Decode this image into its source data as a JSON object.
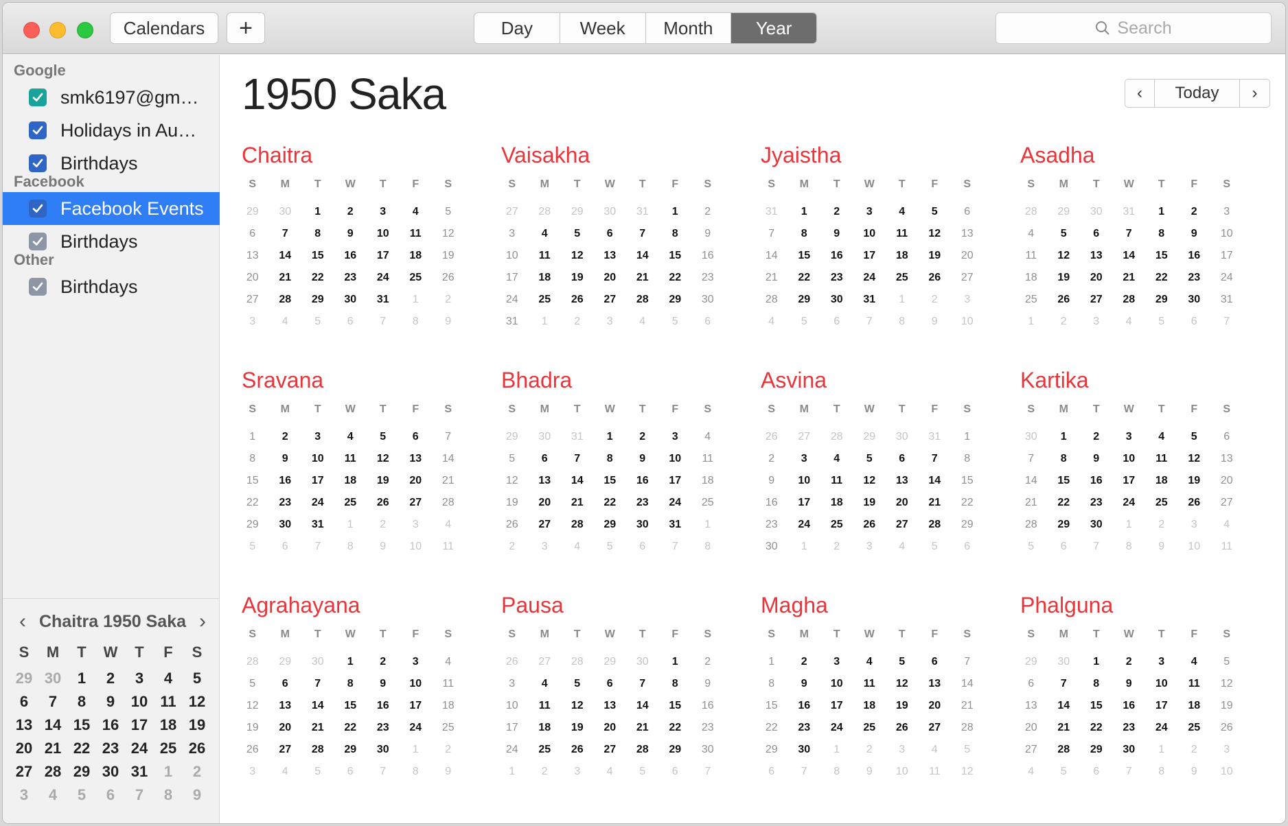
{
  "toolbar": {
    "calendars_label": "Calendars",
    "add_label": "+",
    "views": [
      "Day",
      "Week",
      "Month",
      "Year"
    ],
    "active_view": "Year",
    "search_placeholder": "Search"
  },
  "sidebar": {
    "groups": [
      {
        "title": "Google",
        "items": [
          {
            "label": "smk6197@gm…",
            "color": "#1aa39a"
          },
          {
            "label": "Holidays in Au…",
            "color": "#2f66c6"
          },
          {
            "label": "Birthdays",
            "color": "#2f66c6"
          }
        ]
      },
      {
        "title": "Facebook",
        "items": [
          {
            "label": "Facebook Events",
            "color": "#2f66c6",
            "selected": true
          },
          {
            "label": "Birthdays",
            "color": "#8c96a4"
          }
        ]
      },
      {
        "title": "Other",
        "items": [
          {
            "label": "Birthdays",
            "color": "#8c96a4"
          }
        ]
      }
    ]
  },
  "mini_calendar": {
    "title": "Chaitra 1950 Saka",
    "dow": [
      "S",
      "M",
      "T",
      "W",
      "T",
      "F",
      "S"
    ],
    "weeks": [
      [
        "29",
        "30",
        "1",
        "2",
        "3",
        "4",
        "5"
      ],
      [
        "6",
        "7",
        "8",
        "9",
        "10",
        "11",
        "12"
      ],
      [
        "13",
        "14",
        "15",
        "16",
        "17",
        "18",
        "19"
      ],
      [
        "20",
        "21",
        "22",
        "23",
        "24",
        "25",
        "26"
      ],
      [
        "27",
        "28",
        "29",
        "30",
        "31",
        "1",
        "2"
      ],
      [
        "3",
        "4",
        "5",
        "6",
        "7",
        "8",
        "9"
      ]
    ],
    "out_of_month": [
      [
        0,
        0
      ],
      [
        0,
        1
      ],
      [
        4,
        5
      ],
      [
        4,
        6
      ],
      [
        5,
        0
      ],
      [
        5,
        1
      ],
      [
        5,
        2
      ],
      [
        5,
        3
      ],
      [
        5,
        4
      ],
      [
        5,
        5
      ],
      [
        5,
        6
      ]
    ]
  },
  "main": {
    "year_title": "1950 Saka",
    "nav": {
      "prev": "‹",
      "today": "Today",
      "next": "›"
    },
    "dow": [
      "S",
      "M",
      "T",
      "W",
      "T",
      "F",
      "S"
    ],
    "months": [
      {
        "name": "Chaitra",
        "lead": [
          "29",
          "30"
        ],
        "days": 31,
        "trail": [
          "1",
          "2",
          "3",
          "4",
          "5",
          "6",
          "7",
          "8",
          "9"
        ]
      },
      {
        "name": "Vaisakha",
        "lead": [
          "27",
          "28",
          "29",
          "30",
          "31"
        ],
        "days": 31,
        "trail": [
          "1",
          "2",
          "3",
          "4",
          "5",
          "6"
        ]
      },
      {
        "name": "Jyaistha",
        "lead": [
          "31"
        ],
        "days": 31,
        "trail": [
          "1",
          "2",
          "3",
          "4",
          "5",
          "6",
          "7",
          "8",
          "9",
          "10"
        ]
      },
      {
        "name": "Asadha",
        "lead": [
          "28",
          "29",
          "30",
          "31"
        ],
        "days": 31,
        "trail": [
          "1",
          "2",
          "3",
          "4",
          "5",
          "6",
          "7"
        ]
      },
      {
        "name": "Sravana",
        "lead": [],
        "days": 31,
        "trail": [
          "1",
          "2",
          "3",
          "4",
          "5",
          "6",
          "7",
          "8",
          "9",
          "10",
          "11"
        ]
      },
      {
        "name": "Bhadra",
        "lead": [
          "29",
          "30",
          "31"
        ],
        "days": 31,
        "trail": [
          "1",
          "2",
          "3",
          "4",
          "5",
          "6",
          "7",
          "8"
        ]
      },
      {
        "name": "Asvina",
        "lead": [
          "26",
          "27",
          "28",
          "29",
          "30",
          "31"
        ],
        "days": 30,
        "trail": [
          "1",
          "2",
          "3",
          "4",
          "5",
          "6"
        ]
      },
      {
        "name": "Kartika",
        "lead": [
          "30"
        ],
        "days": 30,
        "trail": [
          "1",
          "2",
          "3",
          "4",
          "5",
          "6",
          "7",
          "8",
          "9",
          "10",
          "11"
        ]
      },
      {
        "name": "Agrahayana",
        "lead": [
          "28",
          "29",
          "30"
        ],
        "days": 30,
        "trail": [
          "1",
          "2",
          "3",
          "4",
          "5",
          "6",
          "7",
          "8",
          "9"
        ]
      },
      {
        "name": "Pausa",
        "lead": [
          "26",
          "27",
          "28",
          "29",
          "30"
        ],
        "days": 30,
        "trail": [
          "1",
          "2",
          "3",
          "4",
          "5",
          "6",
          "7"
        ]
      },
      {
        "name": "Magha",
        "lead": [],
        "days": 30,
        "trail": [
          "1",
          "2",
          "3",
          "4",
          "5",
          "6",
          "7",
          "8",
          "9",
          "10",
          "11",
          "12"
        ]
      },
      {
        "name": "Phalguna",
        "lead": [
          "29",
          "30"
        ],
        "days": 30,
        "trail": [
          "1",
          "2",
          "3",
          "4",
          "5",
          "6",
          "7",
          "8",
          "9",
          "10"
        ]
      }
    ]
  }
}
